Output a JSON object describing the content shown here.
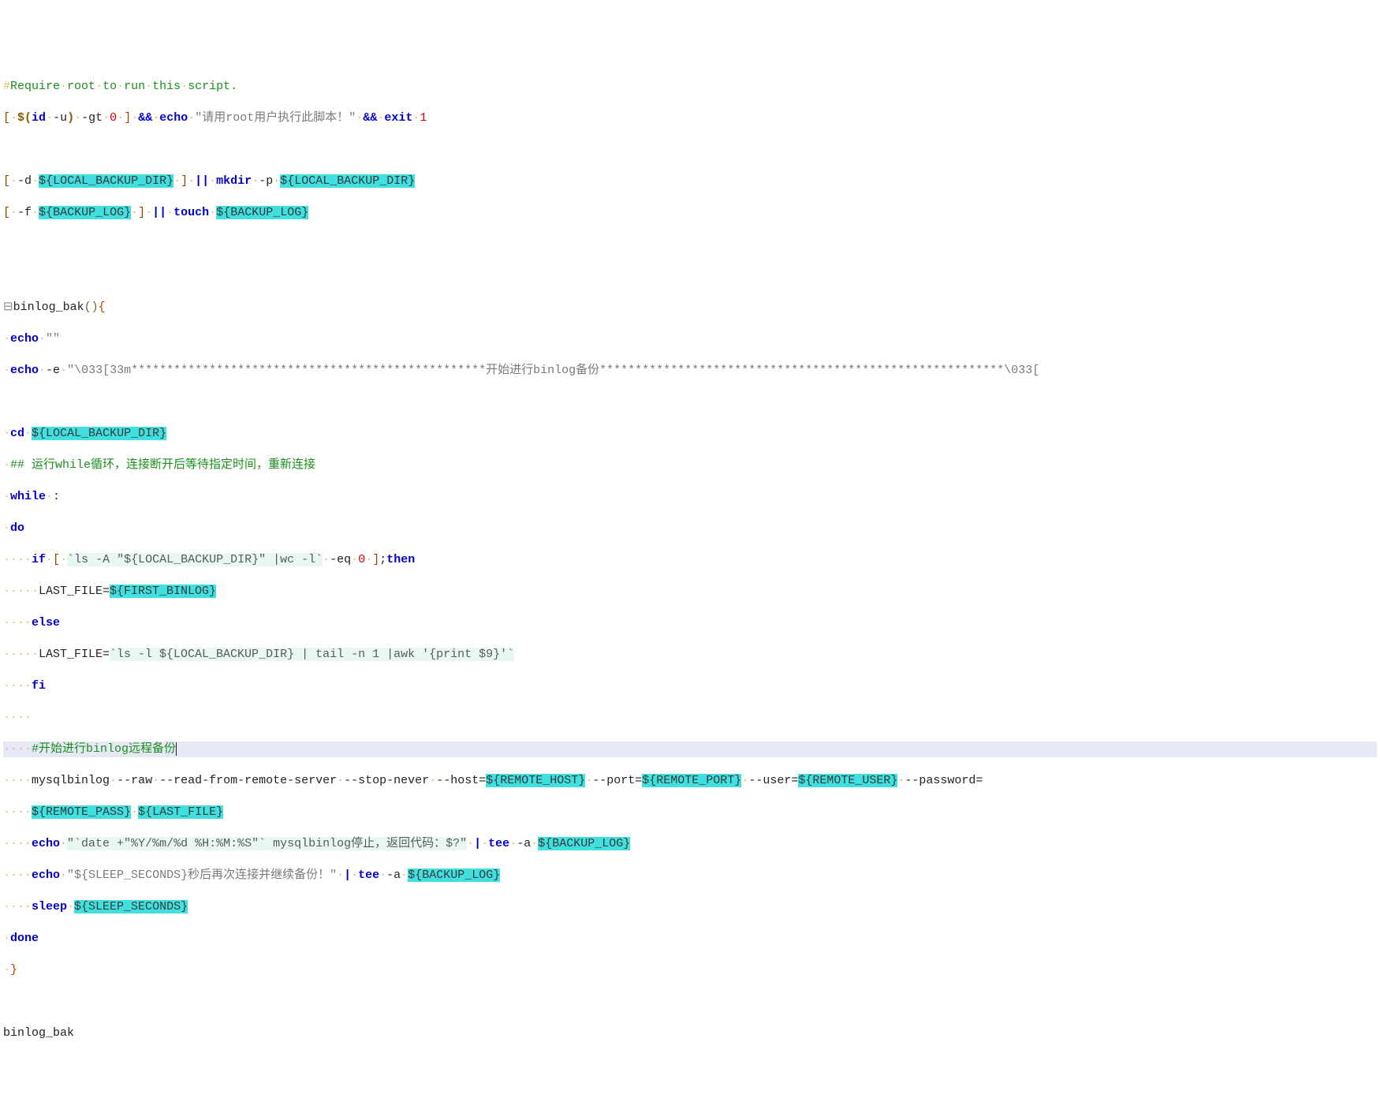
{
  "lines": {
    "l1_comment": "#Require root to run this script.",
    "l2_cmd_id": "id",
    "l2_opt_u": "-u",
    "l2_opt_gt": "-gt",
    "l2_num_0": "0",
    "l2_and": "&&",
    "l2_echo": "echo",
    "l2_str": "\"请用root用户执行此脚本！\"",
    "l2_exit": "exit",
    "l2_num_1": "1",
    "l3_blank": "",
    "l4_d": "-d",
    "l4_var1": "${LOCAL_BACKUP_DIR}",
    "l4_or": "||",
    "l4_mkdir": "mkdir",
    "l4_p": "-p",
    "l4_var2": "${LOCAL_BACKUP_DIR}",
    "l5_f": "-f",
    "l5_var1": "${BACKUP_LOG}",
    "l5_or": "||",
    "l5_touch": "touch",
    "l5_var2": "${BACKUP_LOG}",
    "l8_fn": "binlog_bak",
    "l9_echo": "echo",
    "l9_str": "\"\"",
    "l10_echo": "echo",
    "l10_e": "-e",
    "l10_str": "\"\\033[33m**************************************************开始进行binlog备份*********************************************************\\033[",
    "l12_cd": "cd",
    "l12_var": "${LOCAL_BACKUP_DIR}",
    "l13_comment": "## 运行while循环，连接断开后等待指定时间，重新连接",
    "l14_while": "while",
    "l14_colon": ":",
    "l15_do": "do",
    "l16_if": "if",
    "l16_bt": "`ls -A \"${LOCAL_BACKUP_DIR}\" |wc -l`",
    "l16_eq": "-eq",
    "l16_num": "0",
    "l16_then": "then",
    "l17_lastfile": "LAST_FILE=",
    "l17_var": "${FIRST_BINLOG}",
    "l18_else": "else",
    "l19_lastfile": "LAST_FILE=",
    "l19_bt": "`ls -l ${LOCAL_BACKUP_DIR} | tail -n 1 |awk '{print $9}'`",
    "l20_fi": "fi",
    "l22_comment": "#开始进行binlog远程备份",
    "l23_mysqlbinlog": "mysqlbinlog",
    "l23_raw": "--raw",
    "l23_rfrs": "--read-from-remote-server",
    "l23_sn": "--stop-never",
    "l23_host": "--host=",
    "l23_var_host": "${REMOTE_HOST}",
    "l23_port": "--port=",
    "l23_var_port": "${REMOTE_PORT}",
    "l23_user": "--user=",
    "l23_var_user": "${REMOTE_USER}",
    "l23_pass": "--password=",
    "l24_var_pass": "${REMOTE_PASS}",
    "l24_var_last": "${LAST_FILE}",
    "l25_echo": "echo",
    "l25_bt": "\"`date +\"%Y/%m/%d %H:%M:%S\"` mysqlbinlog停止，返回代码：$?\"",
    "l25_pipe": "|",
    "l25_tee": "tee",
    "l25_a": "-a",
    "l25_var": "${BACKUP_LOG}",
    "l26_echo": "echo",
    "l26_str": "\"${SLEEP_SECONDS}秒后再次连接并继续备份！\"",
    "l26_pipe": "|",
    "l26_tee": "tee",
    "l26_a": "-a",
    "l26_var": "${BACKUP_LOG}",
    "l27_sleep": "sleep",
    "l27_var": "${SLEEP_SECONDS}",
    "l28_done": "done",
    "l30_call": "binlog_bak"
  }
}
